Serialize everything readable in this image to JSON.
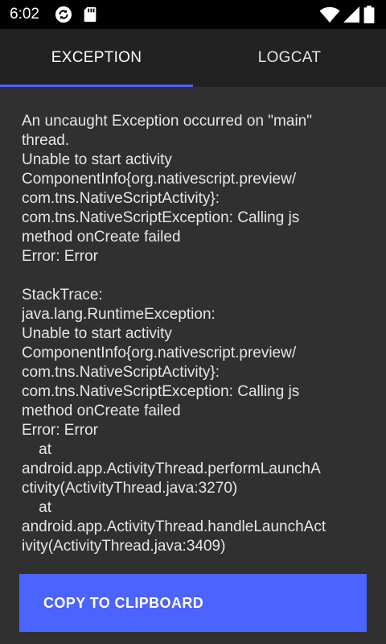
{
  "status_bar": {
    "time": "6:02",
    "icons": [
      "sync-icon",
      "sd-card-icon",
      "wifi-icon",
      "signal-icon",
      "battery-icon"
    ]
  },
  "tabs": [
    {
      "label": "EXCEPTION",
      "active": true
    },
    {
      "label": "LOGCAT",
      "active": false
    }
  ],
  "colors": {
    "accent": "#4b63ff",
    "background": "#303030",
    "tab_bar": "#222222",
    "status_bar": "#000000"
  },
  "exception_text": "An uncaught Exception occurred on \"main\"\nthread.\nUnable to start activity\nComponentInfo{org.nativescript.preview/\ncom.tns.NativeScriptActivity}:\ncom.tns.NativeScriptException: Calling js\nmethod onCreate failed\nError: Error\n\nStackTrace:\njava.lang.RuntimeException:\nUnable to start activity\nComponentInfo{org.nativescript.preview/\ncom.tns.NativeScriptActivity}:\ncom.tns.NativeScriptException: Calling js\nmethod onCreate failed\nError: Error\n    at\nandroid.app.ActivityThread.performLaunchA\nctivity(ActivityThread.java:3270)\n    at\nandroid.app.ActivityThread.handleLaunchAct\nivity(ActivityThread.java:3409)",
  "copy_button_label": "COPY TO CLIPBOARD"
}
